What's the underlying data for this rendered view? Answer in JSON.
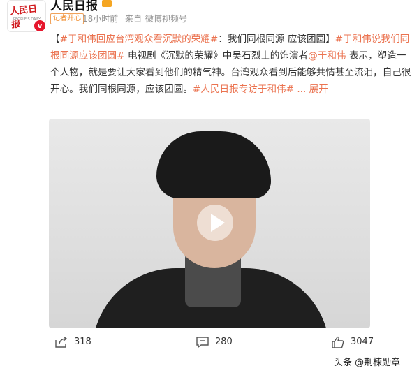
{
  "account": {
    "name": "人民日报",
    "avatar_logo": "人民日报",
    "avatar_sub": "PEOPLE'S DAILY",
    "verified_mark": "v",
    "meta_tag": "记者开心",
    "time": "18小时前",
    "source_label": "来自",
    "client": "微博视频号"
  },
  "post": {
    "hashtag1": "#于和伟回应台湾观众看沉默的荣耀#",
    "sep1": "：我们同根同源 应该团圆】",
    "hashtag2": "#于和伟说我们同根同源应该团圆#",
    "text1": " 电视剧《沉默的荣耀》中吴石烈士的饰演者",
    "mention": "@于和伟",
    "text2": " 表示，塑造一个人物，就是要让大家看到他们的精气神。台湾观众看到后能够共情甚至流泪，自己很开心。我们同根同源，应该团圆。",
    "hashtag3": "#人民日报专访于和伟#",
    "expand": "... 展开"
  },
  "actions": {
    "share_count": "318",
    "comment_count": "280",
    "like_count": "3047"
  },
  "icons": {
    "share": "share-icon",
    "comment": "comment-icon",
    "like": "like-icon",
    "play": "play-icon",
    "verified": "verified-icon"
  },
  "watermark": "头条 @荆楝勋章"
}
